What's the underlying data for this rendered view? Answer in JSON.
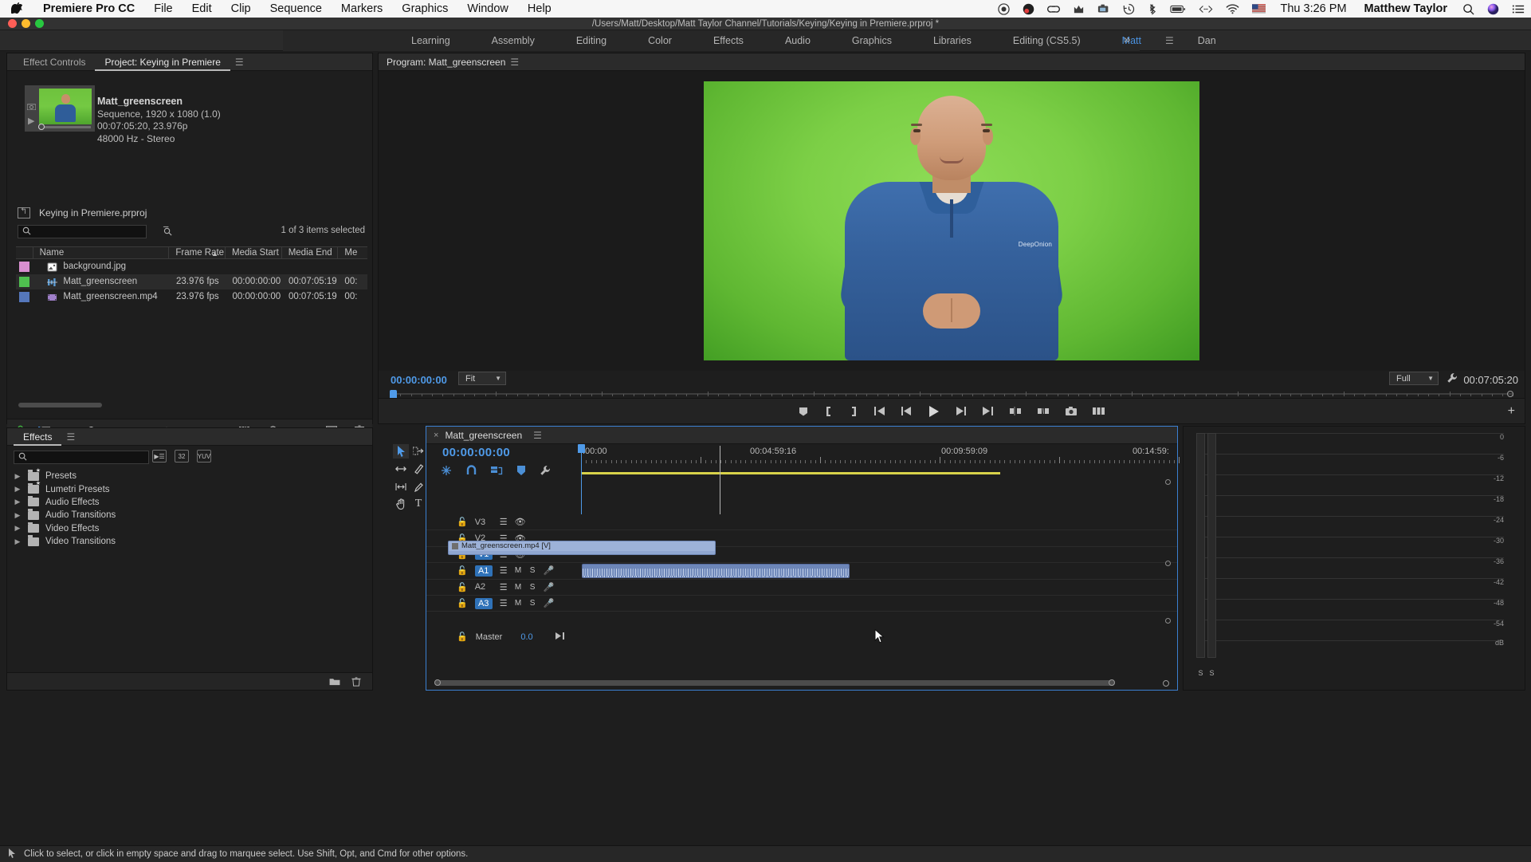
{
  "macmenu": {
    "apple_icon": "apple-icon",
    "app_name": "Premiere Pro CC",
    "items": [
      "File",
      "Edit",
      "Clip",
      "Sequence",
      "Markers",
      "Graphics",
      "Window",
      "Help"
    ],
    "status_icons": [
      "screen-record-icon",
      "obs-icon",
      "creative-cloud-icon",
      "malwarebytes-icon",
      "camera-icon",
      "time-machine-icon",
      "bluetooth-icon",
      "battery-icon",
      "code-icon",
      "wifi-icon",
      "flag-icon"
    ],
    "clock": "Thu 3:26 PM",
    "user": "Matthew Taylor",
    "search_icon": "spotlight-search-icon",
    "siri_icon": "siri-icon",
    "notification_icon": "notification-center-icon"
  },
  "titlebar": {
    "path": "/Users/Matt/Desktop/Matt Taylor Channel/Tutorials/Keying/Keying in Premiere.prproj *"
  },
  "workspaces": {
    "tabs": [
      "Learning",
      "Assembly",
      "Editing",
      "Color",
      "Effects",
      "Audio",
      "Graphics",
      "Libraries",
      "Editing (CS5.5)",
      "Matt",
      "Dan"
    ],
    "active": "Matt",
    "menu_icon": "workspace-menu-icon",
    "overflow_icon": "chevron-double-right-icon"
  },
  "project_panel": {
    "tabs": [
      {
        "label": "Effect Controls",
        "active": false
      },
      {
        "label": "Project: Keying in Premiere",
        "active": true
      }
    ],
    "panel_menu_icon": "panel-menu-icon",
    "preview": {
      "name": "Matt_greenscreen",
      "line1": "Sequence, 1920 x 1080 (1.0)",
      "line2": "00:07:05:20, 23.976p",
      "line3": "48000 Hz - Stereo",
      "camera_icon": "camera-icon",
      "play_icon": "play-icon"
    },
    "root_item": "Keying in Premiere.prproj",
    "root_icon": "project-root-icon",
    "search": {
      "value": "",
      "placeholder": "",
      "icon": "search-icon"
    },
    "find_icon": "find-icon",
    "selection_status": "1 of 3 items selected",
    "columns": [
      "",
      "Name",
      "Frame Rate",
      "Media Start",
      "Media End",
      "Me"
    ],
    "sort_column": "Frame Rate",
    "sort_caret": "ascending-caret-icon",
    "rows": [
      {
        "swatch": "#d98fd0",
        "icon": "image-clip-icon",
        "name": "background.jpg",
        "frame_rate": "",
        "media_start": "",
        "media_end": "",
        "extra": "",
        "selected": false
      },
      {
        "swatch": "#4fbf4f",
        "icon": "sequence-icon",
        "name": "Matt_greenscreen",
        "frame_rate": "23.976 fps",
        "media_start": "00:00:00:00",
        "media_end": "00:07:05:19",
        "extra": "00:",
        "selected": true
      },
      {
        "swatch": "#5577bb",
        "icon": "video-clip-icon",
        "name": "Matt_greenscreen.mp4",
        "frame_rate": "23.976 fps",
        "media_start": "00:00:00:00",
        "media_end": "00:07:05:19",
        "extra": "00:",
        "selected": false
      }
    ],
    "footer_icons": [
      "lock-icon",
      "list-view-icon",
      "icon-view-icon",
      "zoom-slider",
      "freeform-icon",
      "automate-to-sequence-icon",
      "find-icon",
      "new-bin-icon",
      "new-item-icon",
      "delete-icon"
    ]
  },
  "effects_panel": {
    "tab": "Effects",
    "panel_menu_icon": "panel-menu-icon",
    "search": {
      "value": "",
      "placeholder": "",
      "icon": "search-icon"
    },
    "filter_buttons": [
      "accelerated-effects-icon",
      "32-bit-color-icon",
      "yuv-effects-icon"
    ],
    "tree": [
      "Presets",
      "Lumetri Presets",
      "Audio Effects",
      "Audio Transitions",
      "Video Effects",
      "Video Transitions"
    ],
    "footer_icons": [
      "new-custom-bin-icon",
      "delete-custom-item-icon"
    ]
  },
  "program_monitor": {
    "title": "Program: Matt_greenscreen",
    "panel_menu_icon": "panel-menu-icon",
    "timecode": "00:00:00:00",
    "fit_value": "Fit",
    "quality_value": "Full",
    "duration": "00:07:05:20",
    "wrench_icon": "settings-wrench-icon",
    "shirt_logo": "DeepOnion",
    "transport_icons": [
      "add-marker-icon",
      "mark-in-icon",
      "mark-out-icon",
      "go-to-in-icon",
      "step-back-icon",
      "play-icon",
      "step-forward-icon",
      "go-to-out-icon",
      "lift-icon",
      "extract-icon",
      "export-frame-icon",
      "button-editor-icon"
    ],
    "plus_icon": "add-button-icon"
  },
  "timeline": {
    "close_icon": "close-tab-icon",
    "name": "Matt_greenscreen",
    "panel_menu_icon": "panel-menu-icon",
    "timecode": "00:00:00:00",
    "option_icons": [
      "sequence-settings-icon",
      "snap-icon",
      "linked-selection-icon",
      "add-marker-icon",
      "timeline-display-settings-icon"
    ],
    "tools": [
      {
        "name": "selection-tool",
        "glyph": "selection",
        "active": true
      },
      {
        "name": "track-select-forward-tool",
        "glyph": "track-select"
      },
      {
        "name": "ripple-edit-tool",
        "glyph": "ripple"
      },
      {
        "name": "rolling-edit-tool",
        "glyph": "rolling"
      },
      {
        "name": "rate-stretch-tool",
        "glyph": "rate"
      },
      {
        "name": "razor-tool",
        "glyph": "razor"
      },
      {
        "name": "slip-tool",
        "glyph": "slip"
      },
      {
        "name": "pen-tool",
        "glyph": "pen"
      },
      {
        "name": "hand-tool",
        "glyph": "hand"
      },
      {
        "name": "type-tool",
        "glyph": "type"
      }
    ],
    "ruler_labels": [
      ":00:00",
      "00:04:59:16",
      "00:09:59:09",
      "00:14:59:"
    ],
    "video_tracks": [
      {
        "label": "V3",
        "enabled": false
      },
      {
        "label": "V2",
        "enabled": false
      },
      {
        "label": "V1",
        "enabled": true
      }
    ],
    "audio_tracks": [
      {
        "label": "A1",
        "enabled": true,
        "m": "M",
        "s": "S",
        "mic": "mic-icon"
      },
      {
        "label": "A2",
        "enabled": false,
        "m": "M",
        "s": "S",
        "mic": "mic-icon"
      },
      {
        "label": "A3",
        "enabled": true,
        "m": "M",
        "s": "S",
        "mic": "mic-icon"
      }
    ],
    "master": {
      "label": "Master",
      "value": "0.0",
      "end_icon": "output-meter-icon",
      "lock_icon": "lock-icon"
    },
    "clips": [
      {
        "name": "Matt_greenscreen.mp4 [V]",
        "track": "V1",
        "type": "video"
      },
      {
        "name": "",
        "track": "A1",
        "type": "audio"
      }
    ]
  },
  "audio_meters": {
    "scale": [
      "0",
      "-6",
      "-12",
      "-18",
      "-24",
      "-30",
      "-36",
      "-42",
      "-48",
      "-54",
      "dB"
    ],
    "channels": [
      "S",
      "S"
    ]
  },
  "statusbar": {
    "hint": "Click to select, or click in empty space and drag to marquee select. Use Shift, Opt, and Cmd for other options."
  },
  "colors": {
    "accent_blue": "#4f9ae8",
    "panel_bg": "#1e1e1e",
    "chrome": "#2b2b2b",
    "selected_track": "#2f72b8",
    "work_area": "#d8d24a"
  }
}
